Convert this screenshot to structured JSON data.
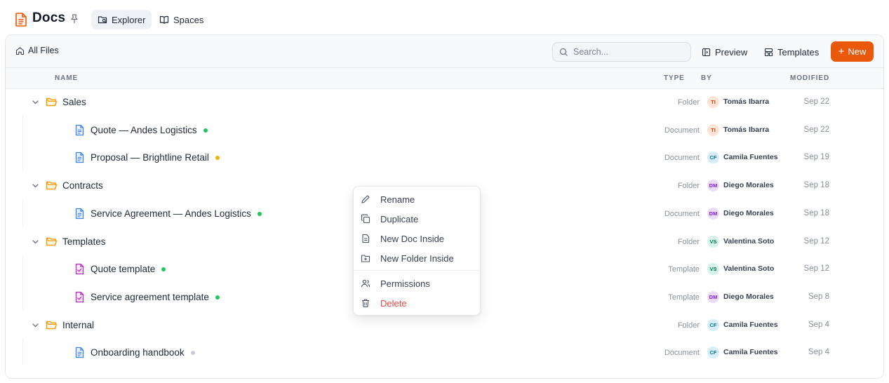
{
  "app": {
    "title": "Docs"
  },
  "nav": {
    "explorer": "Explorer",
    "spaces": "Spaces"
  },
  "toolbar": {
    "breadcrumb": "All Files",
    "search_placeholder": "Search...",
    "preview": "Preview",
    "templates": "Templates",
    "new": "New"
  },
  "columns": {
    "name": "NAME",
    "type": "TYPE",
    "by": "BY",
    "modified": "MODIFIED"
  },
  "rows": [
    {
      "kind": "folder",
      "name": "Sales",
      "type": "Folder",
      "initials": "TI",
      "by": "Tomás Ibarra",
      "modified": "Sep 22"
    },
    {
      "kind": "doc",
      "name": "Quote — Andes Logistics",
      "status": "green",
      "type": "Document",
      "initials": "TI",
      "by": "Tomás Ibarra",
      "modified": "Sep 22"
    },
    {
      "kind": "doc",
      "name": "Proposal — Brightline Retail",
      "status": "amber",
      "type": "Document",
      "initials": "CF",
      "by": "Camila Fuentes",
      "modified": "Sep 19"
    },
    {
      "kind": "folder",
      "name": "Contracts",
      "type": "Folder",
      "initials": "DM",
      "by": "Diego Morales",
      "modified": "Sep 18"
    },
    {
      "kind": "doc",
      "name": "Service Agreement — Andes Logistics",
      "status": "green",
      "type": "Document",
      "initials": "DM",
      "by": "Diego Morales",
      "modified": "Sep 18"
    },
    {
      "kind": "folder",
      "name": "Templates",
      "type": "Folder",
      "initials": "VS",
      "by": "Valentina Soto",
      "modified": "Sep 12"
    },
    {
      "kind": "template",
      "name": "Quote template",
      "status": "green",
      "type": "Template",
      "initials": "VS",
      "by": "Valentina Soto",
      "modified": "Sep 12"
    },
    {
      "kind": "template",
      "name": "Service agreement template",
      "status": "green",
      "type": "Template",
      "initials": "DM",
      "by": "Diego Morales",
      "modified": "Sep 8"
    },
    {
      "kind": "folder",
      "name": "Internal",
      "type": "Folder",
      "initials": "CF",
      "by": "Camila Fuentes",
      "modified": "Sep 4"
    },
    {
      "kind": "doc",
      "name": "Onboarding handbook",
      "status": "gray",
      "type": "Document",
      "initials": "CF",
      "by": "Camila Fuentes",
      "modified": "Sep 4"
    }
  ],
  "context_menu": {
    "rename": "Rename",
    "duplicate": "Duplicate",
    "new_doc": "New Doc Inside",
    "new_folder": "New Folder Inside",
    "permissions": "Permissions",
    "delete": "Delete"
  },
  "colors": {
    "accent": "#ea580c",
    "folder": "#f59e0b",
    "document": "#3b82f6",
    "template": "#c026d3",
    "status_green": "#22c55e",
    "status_amber": "#eab308",
    "status_gray": "#c7ccd3",
    "danger": "#ef4444"
  }
}
